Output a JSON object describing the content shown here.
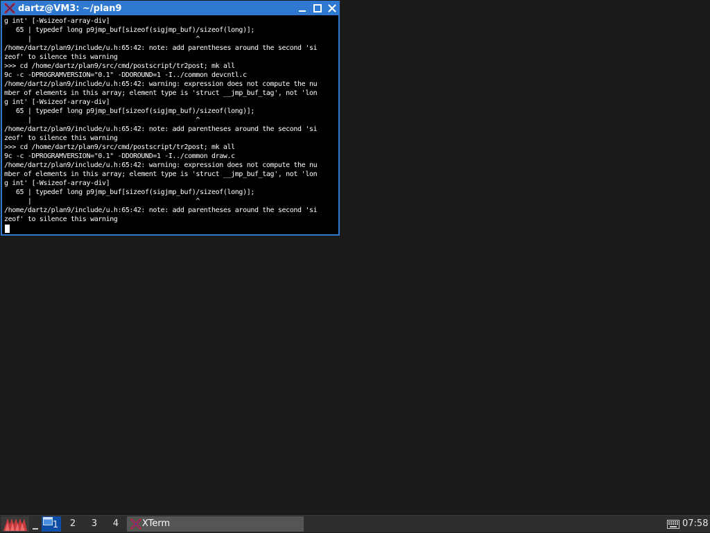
{
  "window": {
    "title": "dartz@VM3: ~/plan9",
    "icons": {
      "app": "xterm-icon",
      "minimize": "minimize-icon",
      "maximize": "maximize-icon",
      "close": "close-icon"
    }
  },
  "terminal": {
    "lines": [
      "g int' [-Wsizeof-array-div]",
      "   65 | typedef long p9jmp_buf[sizeof(sigjmp_buf)/sizeof(long)];",
      "      |                                          ^",
      "/home/dartz/plan9/include/u.h:65:42: note: add parentheses around the second 'si",
      "zeof' to silence this warning",
      ">>> cd /home/dartz/plan9/src/cmd/postscript/tr2post; mk all",
      "9c -c -DPROGRAMVERSION=\"0.1\" -DDOROUND=1 -I../common devcntl.c",
      "/home/dartz/plan9/include/u.h:65:42: warning: expression does not compute the nu",
      "mber of elements in this array; element type is 'struct __jmp_buf_tag', not 'lon",
      "g int' [-Wsizeof-array-div]",
      "   65 | typedef long p9jmp_buf[sizeof(sigjmp_buf)/sizeof(long)];",
      "      |                                          ^",
      "/home/dartz/plan9/include/u.h:65:42: note: add parentheses around the second 'si",
      "zeof' to silence this warning",
      ">>> cd /home/dartz/plan9/src/cmd/postscript/tr2post; mk all",
      "9c -c -DPROGRAMVERSION=\"0.1\" -DDOROUND=1 -I../common draw.c",
      "/home/dartz/plan9/include/u.h:65:42: warning: expression does not compute the nu",
      "mber of elements in this array; element type is 'struct __jmp_buf_tag', not 'lon",
      "g int' [-Wsizeof-array-div]",
      "   65 | typedef long p9jmp_buf[sizeof(sigjmp_buf)/sizeof(long)];",
      "      |                                          ^",
      "/home/dartz/plan9/include/u.h:65:42: note: add parentheses around the second 'si",
      "zeof' to silence this warning"
    ]
  },
  "taskbar": {
    "workspaces": [
      {
        "label": "1",
        "active": true
      },
      {
        "label": "2",
        "active": false
      },
      {
        "label": "3",
        "active": false
      },
      {
        "label": "4",
        "active": false
      }
    ],
    "task": {
      "label": "XTerm",
      "icon": "xterm-icon"
    },
    "clock": "07:58",
    "icons": {
      "menu": "menu-logo-icon",
      "show_desktop": "show-desktop-icon",
      "workspace": "window-icon",
      "keyboard": "keyboard-icon"
    }
  },
  "colors": {
    "desktop": "#1a1a1a",
    "titlebar": "#2f7ad0",
    "terminal_bg": "#000000",
    "terminal_fg": "#ffffff",
    "taskbar": "#2e2e2e",
    "active_workspace": "#0f4fa8",
    "task_button": "#555555"
  }
}
